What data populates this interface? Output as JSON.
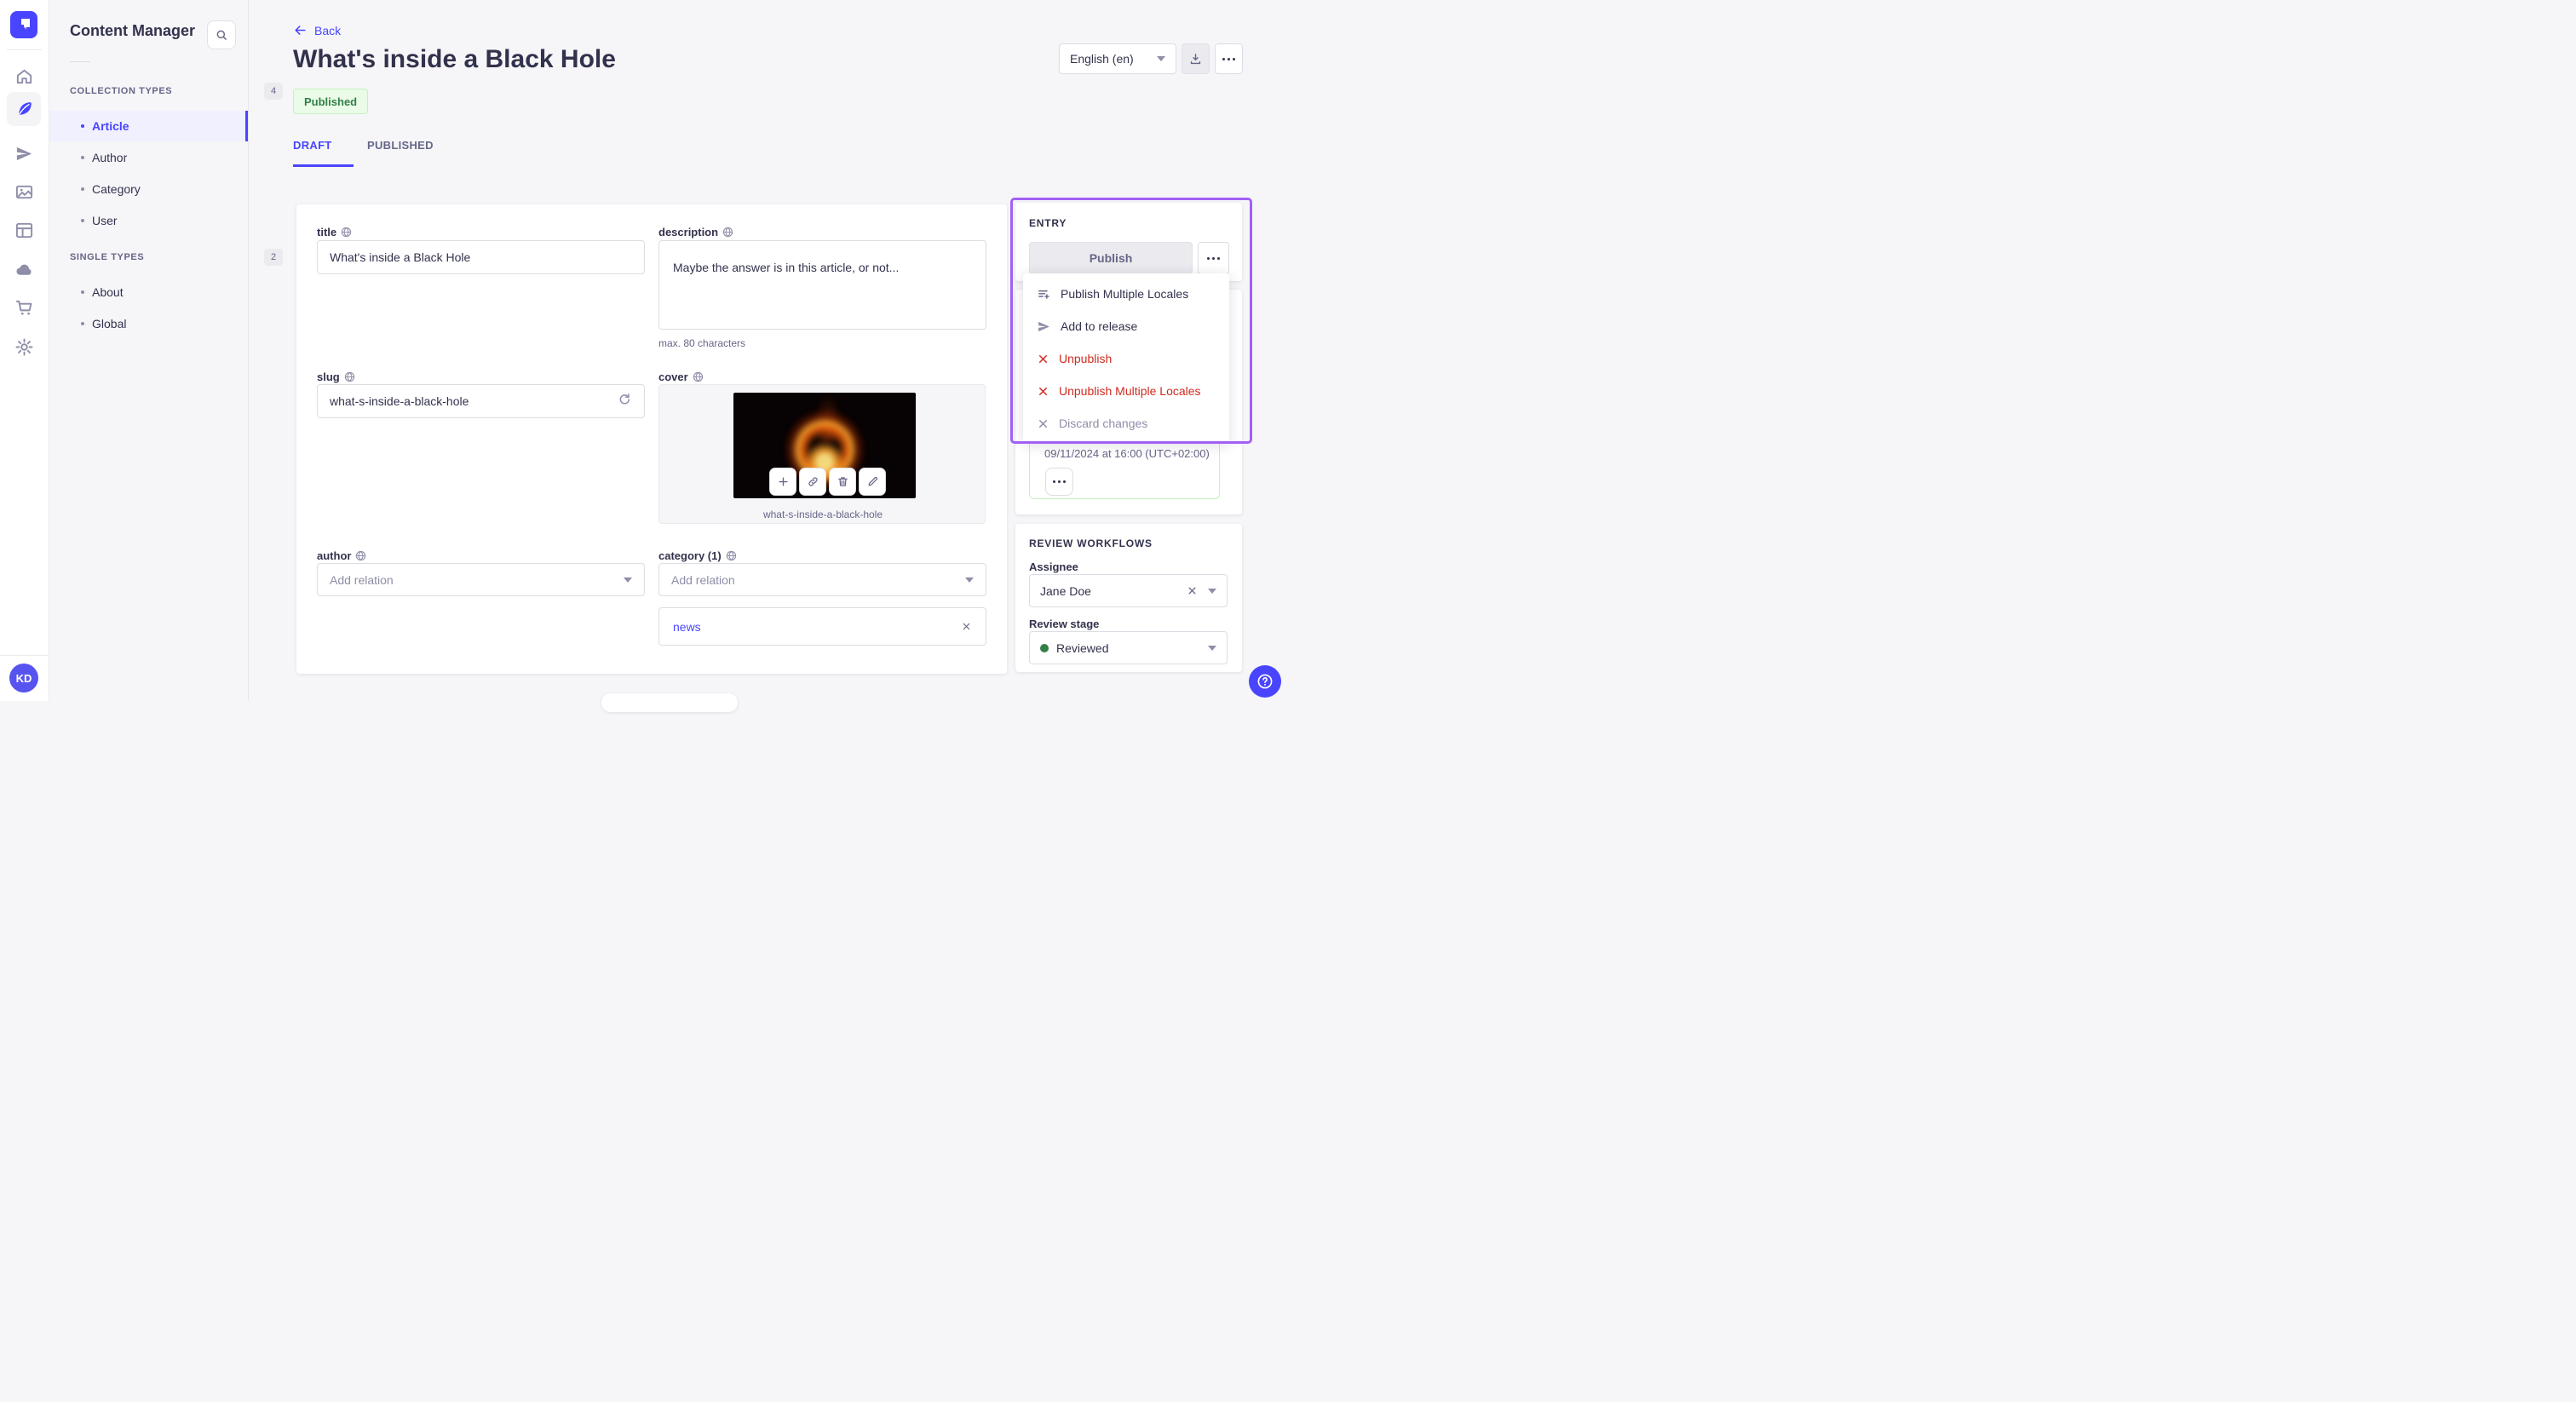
{
  "sidebar": {
    "logo_icon": "strapi-logo",
    "nav_icons": [
      "home-icon",
      "content-manager-feather-icon",
      "releases-plane-icon",
      "media-library-icon",
      "content-type-builder-icon",
      "cloud-icon",
      "marketplace-cart-icon",
      "settings-gear-icon"
    ],
    "user_initials": "KD"
  },
  "subnav": {
    "title": "Content Manager",
    "sections": [
      {
        "label": "COLLECTION TYPES",
        "count": "4",
        "items": [
          {
            "label": "Article"
          },
          {
            "label": "Author"
          },
          {
            "label": "Category"
          },
          {
            "label": "User"
          }
        ]
      },
      {
        "label": "SINGLE TYPES",
        "count": "2",
        "items": [
          {
            "label": "About"
          },
          {
            "label": "Global"
          }
        ]
      }
    ]
  },
  "header": {
    "back_label": "Back",
    "title": "What's inside a Black Hole",
    "status_badge": "Published",
    "locale_value": "English (en)",
    "tabs": [
      {
        "label": "DRAFT",
        "active": true
      },
      {
        "label": "PUBLISHED",
        "active": false
      }
    ]
  },
  "form": {
    "title": {
      "label": "title",
      "value": "What's inside a Black Hole"
    },
    "description": {
      "label": "description",
      "value": "Maybe the answer is in this article, or not...",
      "helper": "max. 80 characters"
    },
    "slug": {
      "label": "slug",
      "value": "what-s-inside-a-black-hole"
    },
    "cover": {
      "label": "cover",
      "caption": "what-s-inside-a-black-hole"
    },
    "author": {
      "label": "author",
      "placeholder": "Add relation"
    },
    "category": {
      "label": "category (1)",
      "placeholder": "Add relation",
      "tag": "news"
    }
  },
  "entry_panel": {
    "heading": "ENTRY",
    "publish_label": "Publish",
    "menu": [
      {
        "label": "Publish Multiple Locales",
        "icon": "playlist-add-icon",
        "style": "default"
      },
      {
        "label": "Add to release",
        "icon": "paper-plane-icon",
        "style": "default"
      },
      {
        "label": "Unpublish",
        "icon": "cross-icon",
        "style": "danger"
      },
      {
        "label": "Unpublish Multiple Locales",
        "icon": "cross-icon",
        "style": "danger"
      },
      {
        "label": "Discard changes",
        "icon": "cross-icon",
        "style": "disabled"
      }
    ]
  },
  "release_panel": {
    "scheduled_text": "09/11/2024 at 16:00 (UTC+02:00)"
  },
  "review_panel": {
    "heading": "REVIEW WORKFLOWS",
    "assignee_label": "Assignee",
    "assignee_value": "Jane Doe",
    "stage_label": "Review stage",
    "stage_value": "Reviewed"
  },
  "colors": {
    "accent": "#4945ff",
    "accent_light_bg": "#f0f0ff",
    "focus_highlight": "#a35ff5",
    "danger": "#d02b20",
    "success_text": "#328048",
    "success_bg": "#eafbe7",
    "success_border": "#c6f0c2",
    "page_bg": "#f6f6f9"
  }
}
